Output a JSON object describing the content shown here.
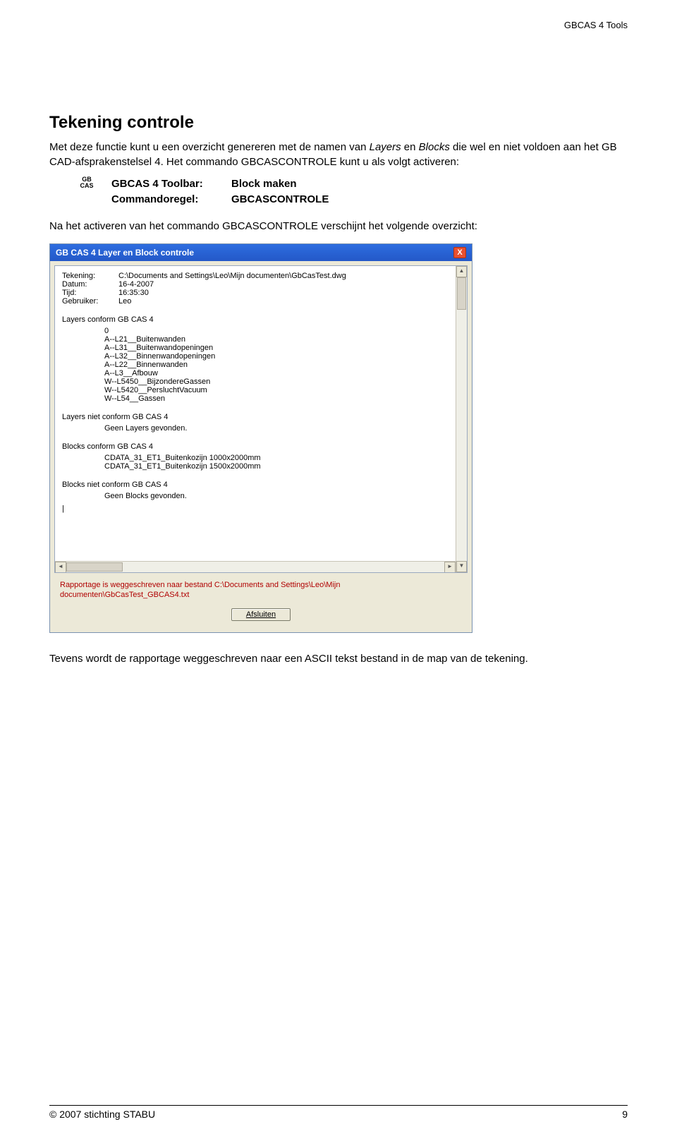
{
  "header": {
    "right": "GBCAS 4 Tools"
  },
  "title": "Tekening controle",
  "intro": {
    "part1": "Met deze functie kunt u een overzicht genereren met de namen van ",
    "em1": "Layers",
    "part2": " en ",
    "em2": "Blocks",
    "part3": " die wel en niet voldoen aan het GB CAD-afsprakenstelsel 4. Het commando GBCASCONTROLE kunt u als volgt activeren:"
  },
  "gbicon": {
    "top": "GB",
    "bot": "CAS"
  },
  "toolbar": {
    "label1": "GBCAS 4 Toolbar:",
    "val1": "Block maken",
    "label2": "Commandoregel:",
    "val2": "GBCASCONTROLE"
  },
  "na_text": "Na het activeren van het commando GBCASCONTROLE verschijnt het volgende overzicht:",
  "dialog": {
    "title": "GB CAS 4 Layer en Block controle",
    "close": "X",
    "meta": {
      "tekening_label": "Tekening:",
      "tekening_val": "C:\\Documents and Settings\\Leo\\Mijn documenten\\GbCasTest.dwg",
      "datum_label": "Datum:",
      "datum_val": "16-4-2007",
      "tijd_label": "Tijd:",
      "tijd_val": "16:35:30",
      "gebruiker_label": "Gebruiker:",
      "gebruiker_val": "Leo"
    },
    "sec1": "Layers conform GB CAS 4",
    "layers": {
      "l0": "0",
      "l1": "A--L21__Buitenwanden",
      "l2": "A--L31__Buitenwandopeningen",
      "l3": "A--L32__Binnenwandopeningen",
      "l4": "A--L22__Binnenwanden",
      "l5": "A--L3__Afbouw",
      "l6": "W--L5450__BijzondereGassen",
      "l7": "W--L5420__PersluchtVacuum",
      "l8": "W--L54__Gassen"
    },
    "sec2": "Layers niet conform GB CAS 4",
    "no_layers": "Geen Layers gevonden.",
    "sec3": "Blocks conform GB CAS 4",
    "blocks": {
      "b1": "CDATA_31_ET1_Buitenkozijn 1000x2000mm",
      "b2": "CDATA_31_ET1_Buitenkozijn 1500x2000mm"
    },
    "sec4": "Blocks niet conform GB CAS 4",
    "no_blocks": "Geen Blocks gevonden.",
    "cursor": "|",
    "rapport": "Rapportage is weggeschreven naar bestand C:\\Documents and Settings\\Leo\\Mijn documenten\\GbCasTest_GBCAS4.txt",
    "button": "Afsluiten"
  },
  "after_dialog": "Tevens wordt de rapportage weggeschreven naar een ASCII tekst bestand in de map van de tekening.",
  "footer": {
    "left": "© 2007 stichting STABU",
    "right": "9"
  }
}
